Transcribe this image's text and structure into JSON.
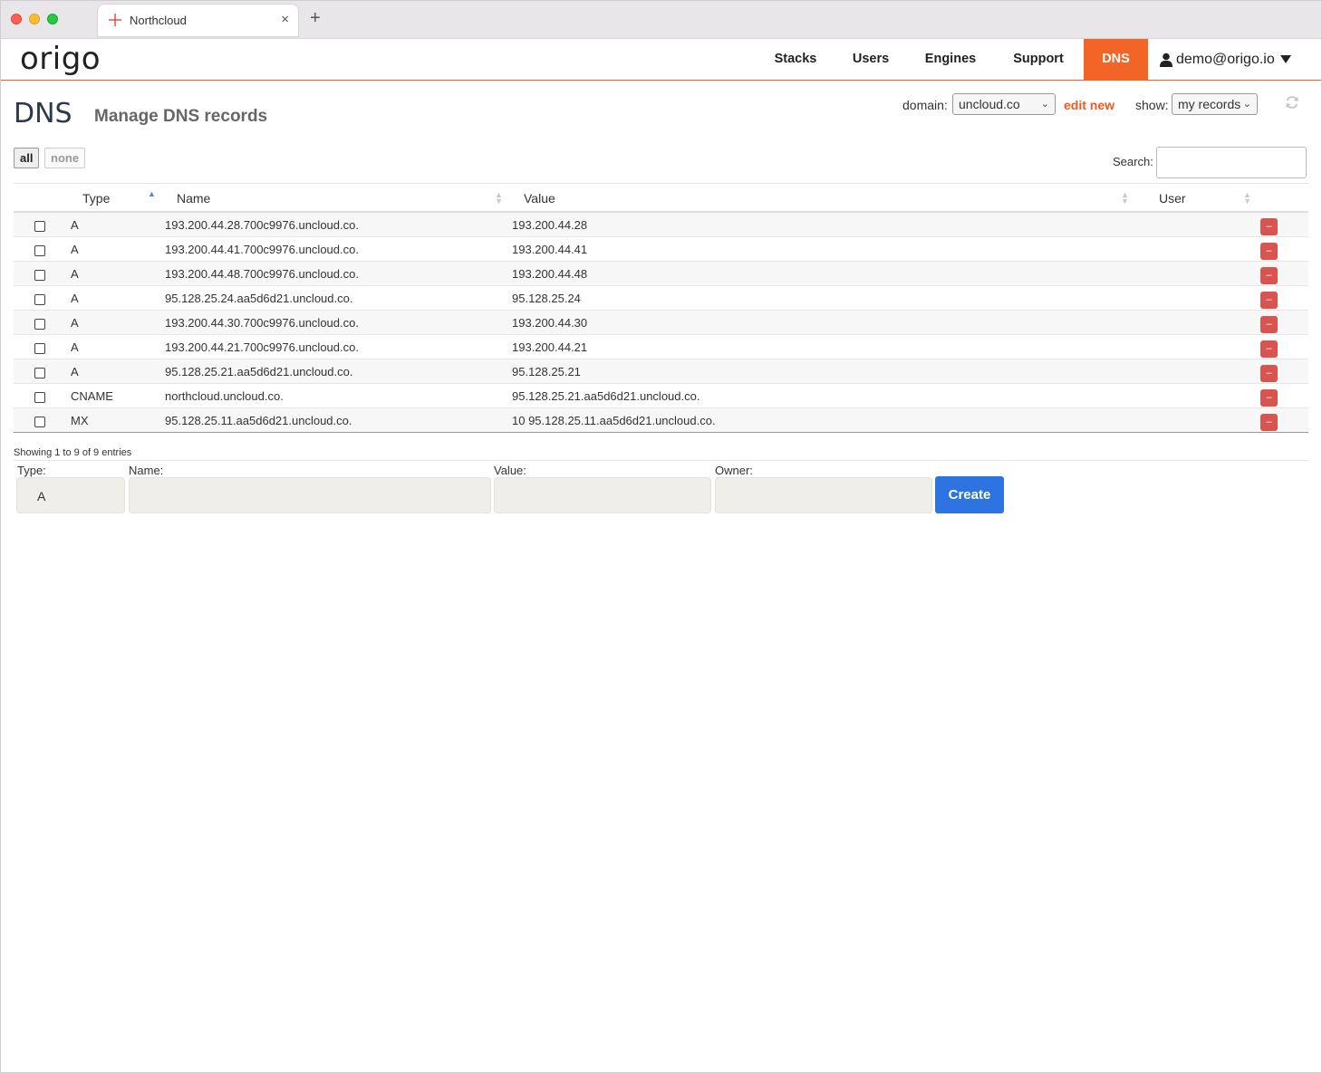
{
  "browser": {
    "tab_title": "Northcloud",
    "new_tab": "+",
    "close": "×"
  },
  "app": {
    "logo": "origo",
    "nav": {
      "stacks": "Stacks",
      "users": "Users",
      "engines": "Engines",
      "support": "Support",
      "dns": "DNS",
      "user": "demo@origo.io"
    },
    "accent_color": "#f36527"
  },
  "page": {
    "title": "DNS",
    "subtitle": "Manage DNS records",
    "domain_label": "domain:",
    "domain_value": "uncloud.co",
    "edit_new": "edit new",
    "show_label": "show:",
    "show_value": "my records",
    "select_all": "all",
    "select_none": "none",
    "search_label": "Search:",
    "search_value": ""
  },
  "table": {
    "columns": [
      "Type",
      "Name",
      "Value",
      "User"
    ],
    "delete_label": "–",
    "rows": [
      {
        "type": "A",
        "name": "193.200.44.28.700c9976.uncloud.co.",
        "value": "193.200.44.28",
        "user": ""
      },
      {
        "type": "A",
        "name": "193.200.44.41.700c9976.uncloud.co.",
        "value": "193.200.44.41",
        "user": ""
      },
      {
        "type": "A",
        "name": "193.200.44.48.700c9976.uncloud.co.",
        "value": "193.200.44.48",
        "user": ""
      },
      {
        "type": "A",
        "name": "95.128.25.24.aa5d6d21.uncloud.co.",
        "value": "95.128.25.24",
        "user": ""
      },
      {
        "type": "A",
        "name": "193.200.44.30.700c9976.uncloud.co.",
        "value": "193.200.44.30",
        "user": ""
      },
      {
        "type": "A",
        "name": "193.200.44.21.700c9976.uncloud.co.",
        "value": "193.200.44.21",
        "user": ""
      },
      {
        "type": "A",
        "name": "95.128.25.21.aa5d6d21.uncloud.co.",
        "value": "95.128.25.21",
        "user": ""
      },
      {
        "type": "CNAME",
        "name": "northcloud.uncloud.co.",
        "value": "95.128.25.21.aa5d6d21.uncloud.co.",
        "user": ""
      },
      {
        "type": "MX",
        "name": "95.128.25.11.aa5d6d21.uncloud.co.",
        "value": "10 95.128.25.11.aa5d6d21.uncloud.co.",
        "user": ""
      }
    ],
    "info": "Showing 1 to 9 of 9 entries"
  },
  "form": {
    "type_label": "Type:",
    "type_value": "A",
    "name_label": "Name:",
    "name_value": "",
    "value_label": "Value:",
    "value_value": "",
    "owner_label": "Owner:",
    "owner_value": "",
    "create": "Create"
  }
}
